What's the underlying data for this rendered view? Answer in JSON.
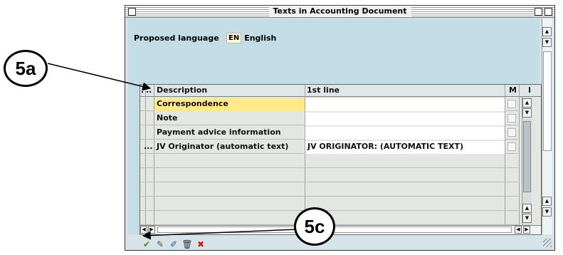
{
  "window": {
    "title": "Texts in Accounting Document"
  },
  "language": {
    "label": "Proposed language",
    "code": "EN",
    "name": "English"
  },
  "table": {
    "headers": {
      "dot1": ".",
      "dot2": "..",
      "description": "Description",
      "line1": "1st line",
      "m": "M",
      "i": "I"
    },
    "rows": [
      {
        "marker": "",
        "description": "Correspondence",
        "line1": "",
        "highlighted": true
      },
      {
        "marker": "",
        "description": "Note",
        "line1": ""
      },
      {
        "marker": "",
        "description": "Payment advice information",
        "line1": ""
      },
      {
        "marker": "...",
        "description": "JV Originator (automatic text)",
        "line1": "JV ORIGINATOR: (AUTOMATIC TEXT)"
      }
    ]
  },
  "toolbar": {
    "icons": [
      "checkmark-icon",
      "edit-icon",
      "edit-all-icon",
      "delete-icon",
      "cancel-icon"
    ]
  },
  "callouts": {
    "a": "5a",
    "c": "5c"
  },
  "colors": {
    "highlight": "#ffe98a",
    "window_bg": "#c3dce5",
    "confirm_green": "#3a8a1c",
    "cancel_red": "#d01818"
  }
}
